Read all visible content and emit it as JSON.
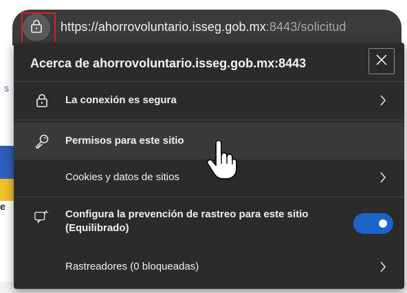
{
  "address_bar": {
    "url_main": "https://ahorrovoluntario.isseg.gob.mx",
    "url_rest": ":8443/solicitud"
  },
  "background": {
    "fragment_left_top": "s",
    "fragment_left_bottom": "e"
  },
  "popup": {
    "title": "Acerca de ahorrovoluntario.isseg.gob.mx:8443",
    "close_icon": "close-icon",
    "rows": [
      {
        "icon": "lock-icon",
        "label": "La conexión es segura",
        "bold": true,
        "chevron": true
      },
      {
        "icon": "key-icon",
        "label": "Permisos para este sitio",
        "bold": true,
        "chevron": false,
        "hovered": true
      },
      {
        "icon": null,
        "label": "Cookies y datos de sitios",
        "bold": false,
        "chevron": true
      },
      {
        "icon": "tracking-prevention-icon",
        "label_line1": "Configura la prevención de rastreo para este sitio",
        "label_line2": "(Equilibrado)",
        "bold": true,
        "toggle_on": true
      },
      {
        "icon": null,
        "label": "Rastreadores (0 bloqueadas)",
        "bold": false,
        "chevron": true
      }
    ]
  },
  "colors": {
    "popup_bg": "#2b2b2b",
    "toggle_on": "#1a64c8",
    "highlight_box": "#e02020"
  }
}
